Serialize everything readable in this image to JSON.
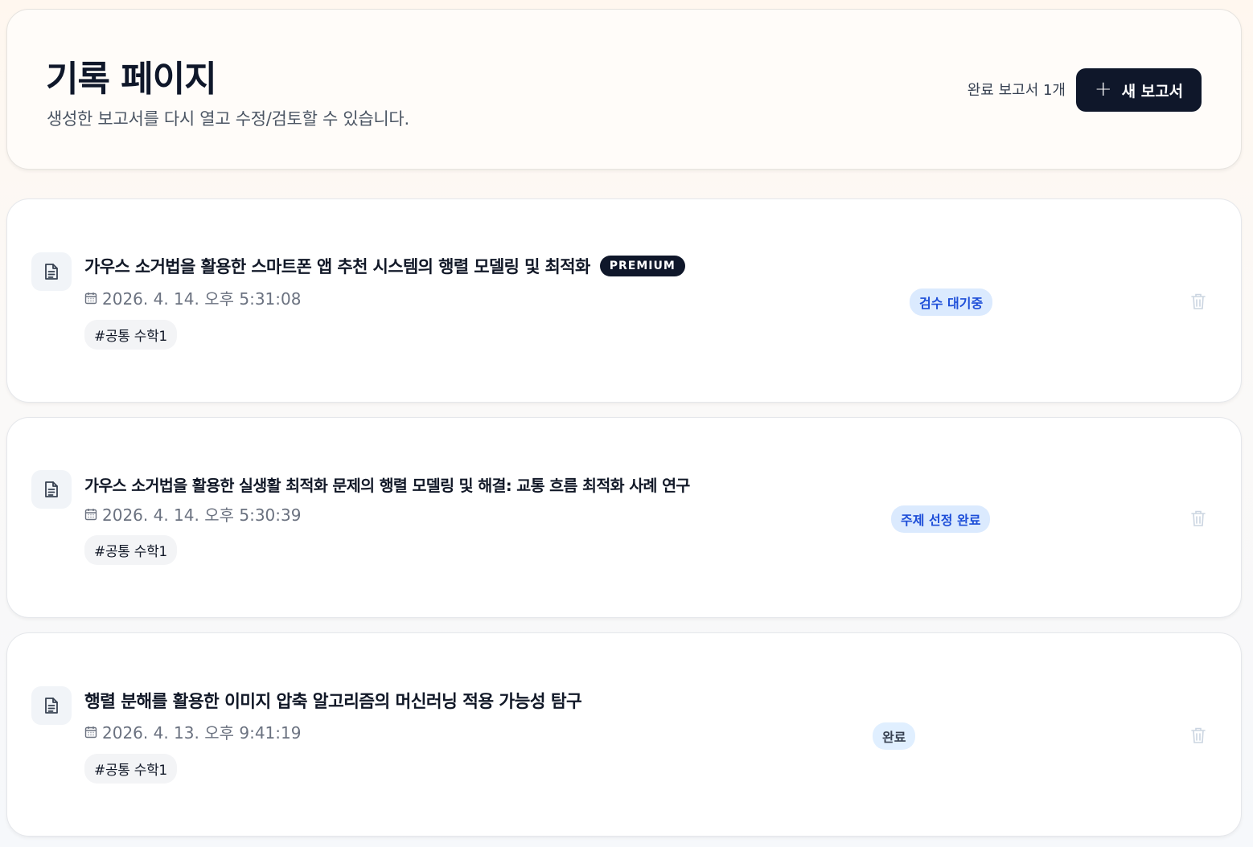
{
  "header": {
    "title": "기록 페이지",
    "subtitle": "생성한 보고서를 다시 열고 수정/검토할 수 있습니다.",
    "completed_count": "완료 보고서 1개",
    "new_report_label": "새 보고서",
    "new_report_icon": "+"
  },
  "reports": [
    {
      "title": "가우스 소거법을 활용한 스마트폰 앱 추천 시스템의 행렬 모델링 및 최적화",
      "badge": "PREMIUM",
      "date": "2026. 4. 14. 오후 5:31:08",
      "tag": "#공통 수학1",
      "status": "검수 대기중"
    },
    {
      "title": "가우스 소거법을 활용한 실생활 최적화 문제의 행렬 모델링 및 해결: 교통 흐름 최적화 사례 연구",
      "date": "2026. 4. 14. 오후 5:30:39",
      "tag": "#공통 수학1",
      "status": "주제 선정 완료"
    },
    {
      "title": "행렬 분해를 활용한 이미지 압축 알고리즘의 머신러닝 적용 가능성 탐구",
      "date": "2026. 4. 13. 오후 9:41:19",
      "tag": "#공통 수학1",
      "status": "완료"
    }
  ],
  "icons": {
    "document": "document-icon",
    "calendar": "calendar-icon",
    "trash": "trash-icon"
  },
  "colors": {
    "primary_dark": "#0f172a",
    "status_blue_bg": "#dbeafe",
    "status_blue_text": "#1d4ed8"
  }
}
